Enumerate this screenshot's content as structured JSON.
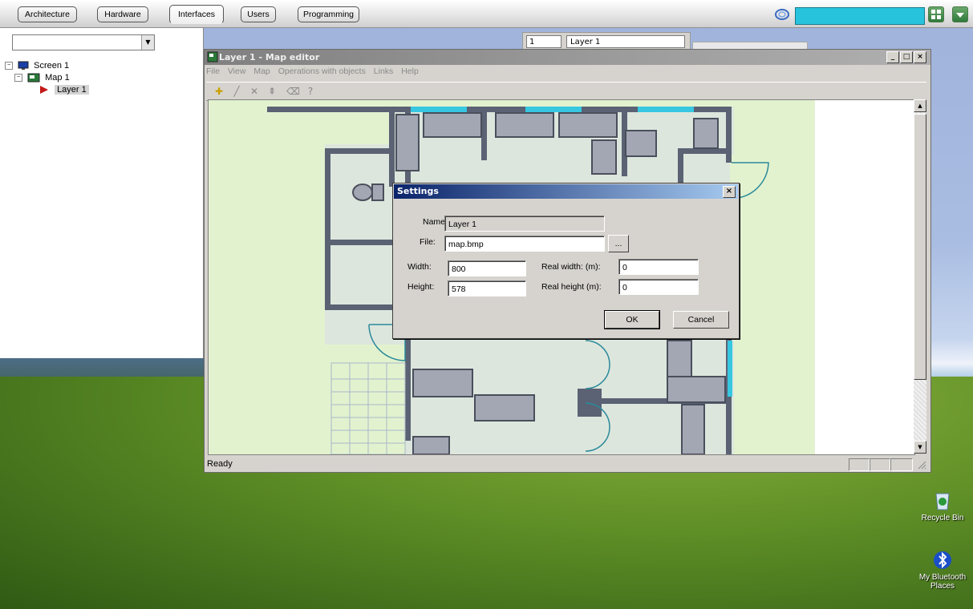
{
  "top_tabs": [
    {
      "label": "Architecture"
    },
    {
      "label": "Hardware"
    },
    {
      "label": "Interfaces",
      "active": true
    },
    {
      "label": "Users"
    },
    {
      "label": "Programming"
    }
  ],
  "tree": [
    {
      "label": "Screen 1",
      "icon": "monitor-icon",
      "expander": "⊟"
    },
    {
      "label": "Map 1",
      "icon": "map-icon",
      "expander": "⊟"
    },
    {
      "label": "Layer 1",
      "icon": "layer-icon",
      "selected": true
    }
  ],
  "layer_tab": {
    "number": "1",
    "name": "Layer 1"
  },
  "map_editor": {
    "title": "Layer 1 - Map editor",
    "menu": [
      "File",
      "View",
      "Map",
      "Operations with objects",
      "Links",
      "Help"
    ],
    "toolbar": [
      {
        "icon": "add-object-icon",
        "glyph": "✚"
      },
      {
        "icon": "draw-line-icon",
        "glyph": "╱"
      },
      {
        "icon": "delete-icon",
        "glyph": "✕"
      },
      {
        "icon": "link-icon",
        "glyph": "⇞"
      },
      {
        "icon": "eraser-icon",
        "glyph": "⌫"
      },
      {
        "icon": "help-icon",
        "glyph": "?"
      }
    ],
    "status": "Ready",
    "controls": {
      "minimize": "_",
      "maximize": "□",
      "close": "×"
    }
  },
  "settings": {
    "title": "Settings",
    "close": "×",
    "name_label": "Name",
    "name_value": "Layer 1",
    "file_label": "File:",
    "file_value": "map.bmp",
    "browse_label": "...",
    "width_label": "Width:",
    "width_value": "800",
    "height_label": "Height:",
    "height_value": "578",
    "real_width_label": "Real width: (m):",
    "real_width_value": "0",
    "real_height_label": "Real height (m):",
    "real_height_value": "0",
    "ok_label": "OK",
    "cancel_label": "Cancel"
  },
  "desktop_icons": [
    {
      "label": "Recycle Bin",
      "icon": "recycle-bin-icon"
    },
    {
      "label": "My Bluetooth Places",
      "icon": "bluetooth-icon"
    }
  ],
  "colors": {
    "accent": "#27c3dd",
    "dialog_title": "#0a246a",
    "map_floor": "#dde6dd",
    "map_wall": "#5a6273",
    "map_outside": "#e2f2cf"
  }
}
